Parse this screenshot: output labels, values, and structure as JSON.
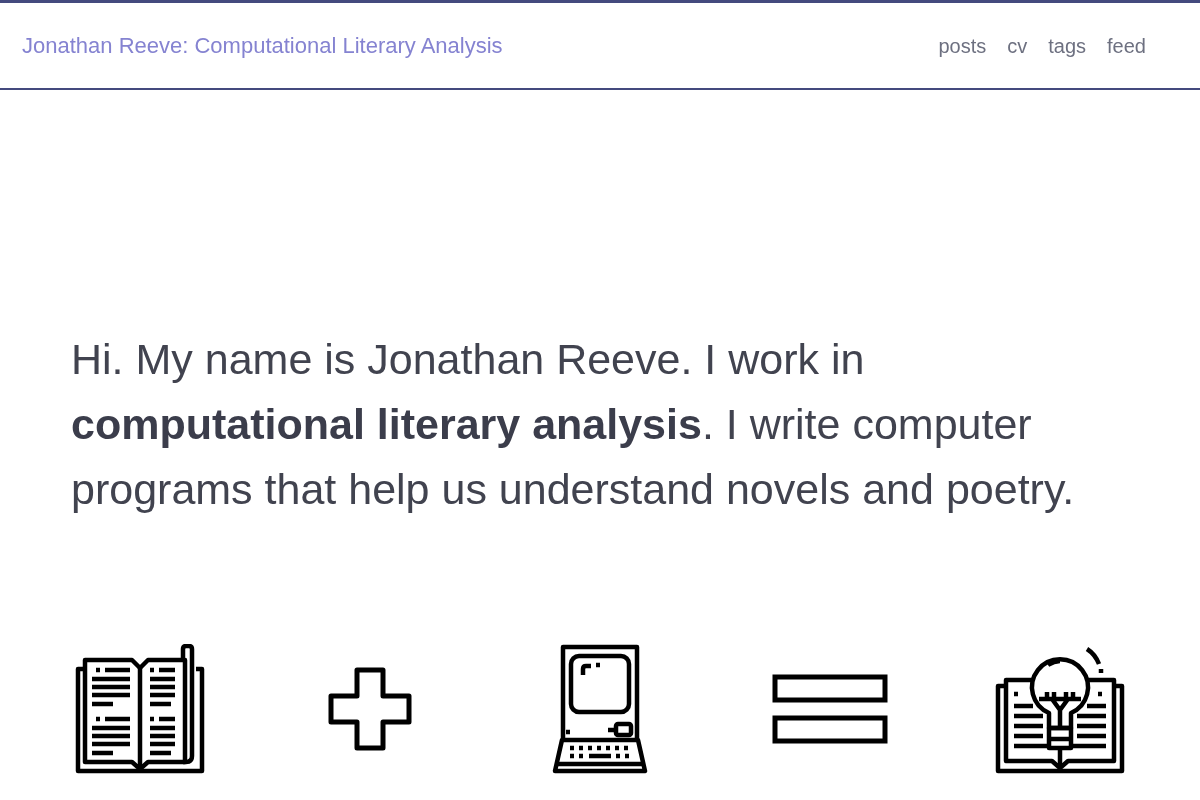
{
  "header": {
    "title": "Jonathan Reeve: Computational Literary Analysis",
    "nav": [
      "posts",
      "cv",
      "tags",
      "feed"
    ]
  },
  "intro": "Hi. My name is Jonathan Reeve. I work in **computational literary analysis**. I write computer programs that help us understand novels and poetry."
}
